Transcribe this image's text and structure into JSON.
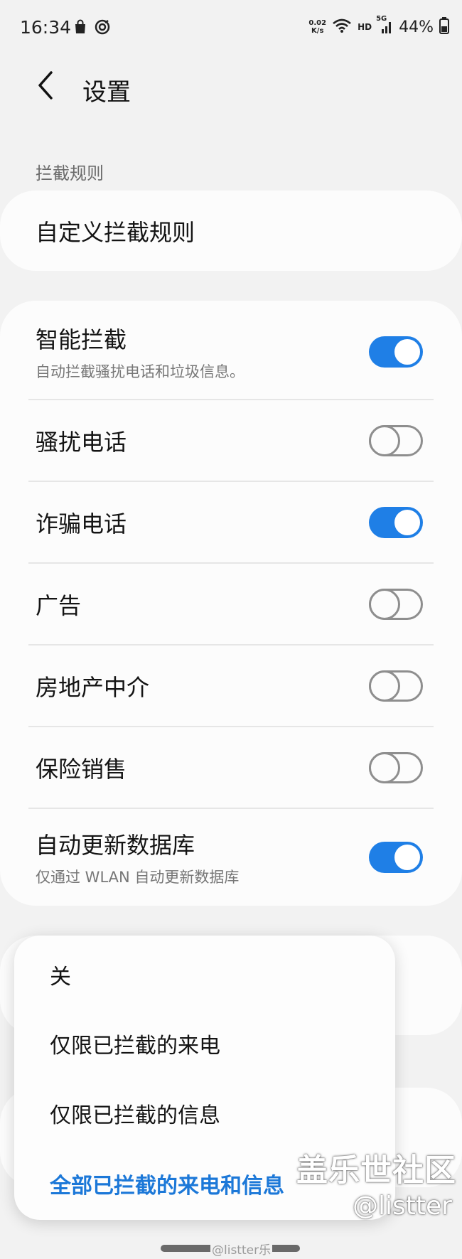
{
  "status_bar": {
    "time": "16:34",
    "netspeed_value": "0.02",
    "netspeed_unit": "K/s",
    "hd": "HD",
    "network": "5G",
    "battery": "44%"
  },
  "header": {
    "title": "设置"
  },
  "section": {
    "label": "拦截规则"
  },
  "custom_rules": {
    "label": "自定义拦截规则"
  },
  "settings": [
    {
      "label": "智能拦截",
      "sub": "自动拦截骚扰电话和垃圾信息。",
      "on": true
    },
    {
      "label": "骚扰电话",
      "sub": "",
      "on": false
    },
    {
      "label": "诈骗电话",
      "sub": "",
      "on": true
    },
    {
      "label": "广告",
      "sub": "",
      "on": false
    },
    {
      "label": "房地产中介",
      "sub": "",
      "on": false
    },
    {
      "label": "保险销售",
      "sub": "",
      "on": false
    },
    {
      "label": "自动更新数据库",
      "sub": "仅通过 WLAN 自动更新数据库",
      "on": true
    }
  ],
  "popup": {
    "options": [
      "关",
      "仅限已拦截的来电",
      "仅限已拦截的信息",
      "全部已拦截的来电和信息"
    ],
    "selected_index": 3
  },
  "watermark": {
    "site": "盖乐世社区",
    "handle": "@listter",
    "weibo": "@listter乐"
  },
  "colors": {
    "accent": "#1f7fe6",
    "selected_text": "#1c78d8",
    "background": "#f2f2f2",
    "card": "#fcfcfc"
  }
}
